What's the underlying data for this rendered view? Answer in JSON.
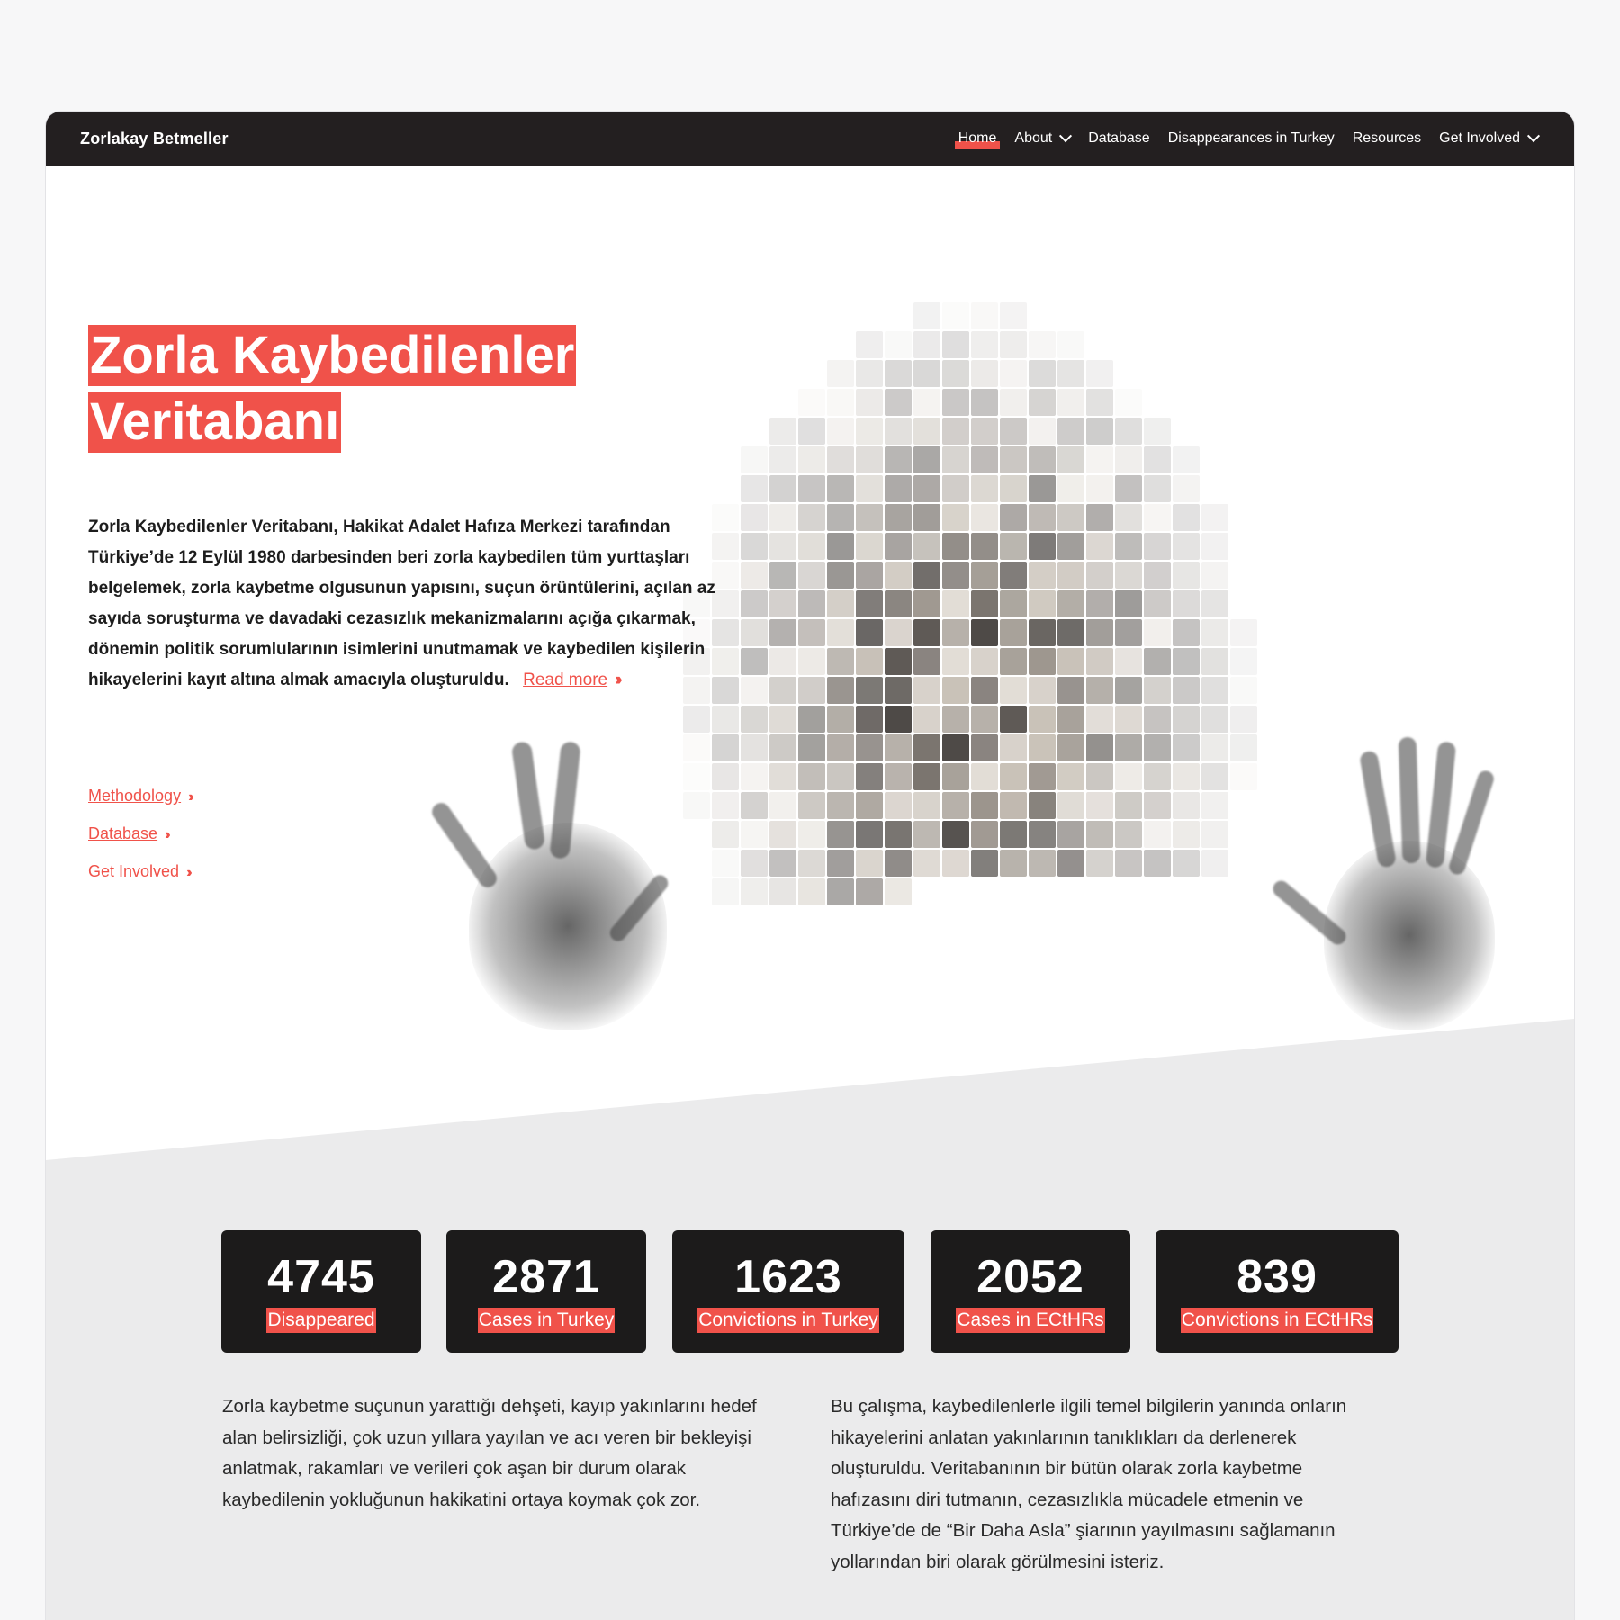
{
  "navbar": {
    "brand": "Zorlakay Betmeller",
    "items": [
      {
        "label": "Home",
        "dropdown": false,
        "active": true
      },
      {
        "label": "About",
        "dropdown": true,
        "active": false
      },
      {
        "label": "Database",
        "dropdown": false,
        "active": false
      },
      {
        "label": "Disappearances in Turkey",
        "dropdown": false,
        "active": false
      },
      {
        "label": "Resources",
        "dropdown": false,
        "active": false
      },
      {
        "label": "Get Involved",
        "dropdown": true,
        "active": false
      }
    ]
  },
  "hero": {
    "title_line1": "Zorla Kaybedilenler",
    "title_line2": "Veritabanı",
    "intro": "Zorla Kaybedilenler Veritabanı, Hakikat Adalet Hafıza Merkezi tarafından Türkiye’de 12 Eylül 1980 darbesinden beri zorla kaybedilen tüm yurttaşları belgelemek, zorla kaybetme olgusunun yapısını, suçun örüntülerini, açılan az sayıda soruşturma ve davadaki cezasızlık mekanizmalarını açığa çıkarmak, dönemin politik sorumlularının isimlerini unutmamak ve kaybedilen kişilerin hikayelerini kayıt altına almak amacıyla oluşturuldu.",
    "read_more": "Read more",
    "links": [
      "Methodology",
      "Database",
      "Get Involved"
    ]
  },
  "stats": [
    {
      "value": "4745",
      "label": "Disappeared"
    },
    {
      "value": "2871",
      "label": "Cases in Turkey"
    },
    {
      "value": "1623",
      "label": "Convictions in Turkey"
    },
    {
      "value": "2052",
      "label": "Cases in ECtHRs"
    },
    {
      "value": "839",
      "label": "Convictions in ECtHRs"
    }
  ],
  "paragraphs": {
    "left": "Zorla kaybetme suçunun yarattığı dehşeti, kayıp yakınlarını hedef alan belirsizliği, çok uzun yıllara yayılan ve acı veren bir bekleyişi anlatmak, rakamları ve verileri çok aşan bir durum olarak kaybedilenin yokluğunun hakikatini ortaya koymak çok zor.",
    "right": "Bu çalışma, kaybedilenlerle ilgili temel bilgilerin yanında onların hikayelerini anlatan yakınlarının tanıklıkları da derlenerek oluşturuldu. Veritabanının bir bütün olarak zorla kaybetme hafızasını diri tutmanın, cezasızlıkla mücadele etmenin ve Türkiye’de de “Bir Daha Asla” şiarının yayılmasını sağlamanın yollarından biri olarak görülmesini isteriz."
  },
  "colors": {
    "accent": "#f0524a",
    "navbar": "#231f20",
    "stat_card": "#1c1b1b",
    "band": "#ebebec"
  },
  "icons": [
    "chevron-down-icon",
    "double-chevron-right-icon"
  ]
}
